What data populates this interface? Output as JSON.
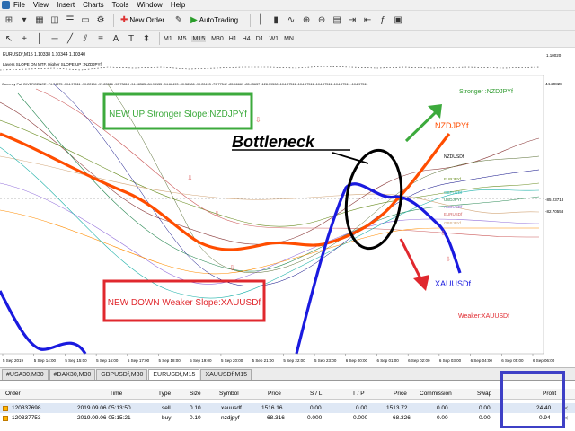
{
  "menu": {
    "items": [
      "File",
      "View",
      "Insert",
      "Charts",
      "Tools",
      "Window",
      "Help"
    ]
  },
  "toolbar": {
    "new_order": "New Order",
    "autotrading": "AutoTrading",
    "timeframes": [
      "M1",
      "M5",
      "M15",
      "M30",
      "H1",
      "H4",
      "D1",
      "W1",
      "MN"
    ],
    "active_timeframe": "M15"
  },
  "chart": {
    "symbol_line": "EURUSDf,M15  1.10338 1.10344 1.10340",
    "indicator_line": "Layers SLOPE ON MTF, Higher SLOPE UP : NZDJPYf",
    "currency_line": "Currency Pair DIVERGENCE -74.74875 -104.97511 -90.22194 -97.83326 -90.73818 -94.08385 -84.93155 -94.66493 -90.58386 -90.20493 -79.77542 -85.46669 -85.43637 -128.19508 -104.97511 -104.97511 -104.97511 -104.97511 -104.97511",
    "price_levels": [
      "1.10020",
      "44.29828",
      "-85.23718",
      "-82.70558"
    ],
    "time_labels": [
      "5 Sep 2019",
      "5 Sep 14:00",
      "5 Sep 15:00",
      "5 Sep 16:00",
      "5 Sep 17:00",
      "5 Sep 18:00",
      "5 Sep 19:00",
      "5 Sep 20:00",
      "5 Sep 21:00",
      "5 Sep 22:00",
      "5 Sep 23:00",
      "6 Sep 00:00",
      "6 Sep 01:00",
      "6 Sep 02:00",
      "6 Sep 03:00",
      "6 Sep 04:00",
      "6 Sep 05:00",
      "6 Sep 06:00"
    ],
    "right_labels": {
      "strong": "Stronger :NZDJPYf",
      "nzdjpy": "NZDJPYf",
      "xauusd": "XAUUSDf",
      "weak": "Weaker:XAUUSDf",
      "mini": [
        "NZDUSDf",
        "EURJPYf",
        "GBPUSDf",
        "USDJPYf",
        "AUDUSDf",
        "EURUSDf",
        "GBPJPYf"
      ]
    },
    "annotations": {
      "up_box": "NEW UP Stronger Slope:NZDJPYf",
      "down_box": "NEW DOWN Weaker Slope:XAUUSDf",
      "bottleneck": "Bottleneck"
    }
  },
  "tabs": [
    "#USA30,M30",
    "#DAX30,M30",
    "GBPUSDf,M30",
    "EURUSDf,M15",
    "XAUUSDf,M15"
  ],
  "active_tab": "EURUSDf,M15",
  "terminal": {
    "headers": [
      "Order",
      "Time",
      "Type",
      "Size",
      "Symbol",
      "Price",
      "S / L",
      "T / P",
      "Price",
      "Commission",
      "Swap",
      "Profit"
    ],
    "rows": [
      [
        "120337698",
        "2019.09.06 05:13:50",
        "sell",
        "0.10",
        "xauusdf",
        "1516.16",
        "0.00",
        "0.00",
        "1513.72",
        "0.00",
        "0.00",
        "24.40"
      ],
      [
        "120337753",
        "2019.09.06 05:15:21",
        "buy",
        "0.10",
        "nzdjpyf",
        "68.316",
        "0.000",
        "0.000",
        "68.326",
        "0.00",
        "0.00",
        "0.94"
      ]
    ]
  },
  "colors": {
    "strong_line": "#ff4d00",
    "weak_line": "#1a1adf",
    "up_box": "#3caa3c",
    "down_box": "#e0282e",
    "profit_box": "#3e40c6"
  }
}
